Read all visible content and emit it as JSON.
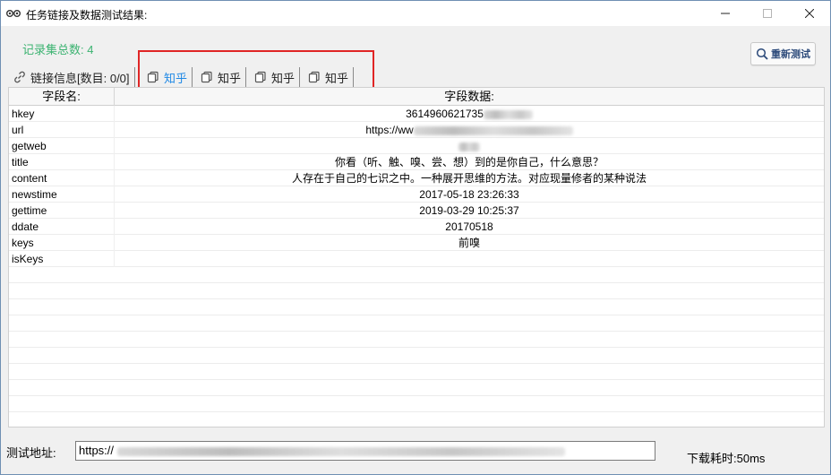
{
  "window": {
    "title": "任务链接及数据测试结果:",
    "icons": {
      "app": "eyes-icon",
      "minimize": "minimize-icon",
      "maximize": "maximize-icon",
      "close": "close-icon"
    }
  },
  "summary": {
    "record_count": "记录集总数: 4"
  },
  "toolbar": {
    "retest_label": "重新测试",
    "retest_icon": "search-icon"
  },
  "tabs": [
    {
      "label": "链接信息[数目: 0/0]",
      "icon": "link-icon"
    },
    {
      "label": "知乎",
      "icon": "copy-icon",
      "active": true
    },
    {
      "label": "知乎",
      "icon": "copy-icon"
    },
    {
      "label": "知乎",
      "icon": "copy-icon"
    },
    {
      "label": "知乎",
      "icon": "copy-icon"
    }
  ],
  "grid": {
    "headers": {
      "name": "字段名:",
      "value": "字段数据:"
    },
    "rows": [
      {
        "name": "hkey",
        "value": "3614960621735"
      },
      {
        "name": "url",
        "value": "https://ww"
      },
      {
        "name": "getweb",
        "value": ""
      },
      {
        "name": "title",
        "value": "你看（听、触、嗅、尝、想）到的是你自己，什么意思？"
      },
      {
        "name": "content",
        "value": "人存在于自己的七识之中。一种展开思维的方法。对应现量修者的某种说法"
      },
      {
        "name": "newstime",
        "value": "2017-05-18 23:26:33"
      },
      {
        "name": "gettime",
        "value": "2019-03-29 10:25:37"
      },
      {
        "name": "ddate",
        "value": "20170518"
      },
      {
        "name": "keys",
        "value": "前嗅"
      },
      {
        "name": "isKeys",
        "value": ""
      }
    ]
  },
  "footer": {
    "url_label": "测试地址:",
    "url_value": "https://",
    "download_time": "下载耗时:50ms"
  },
  "colors": {
    "record_count": "#3cb371",
    "active_tab": "#1e88e5",
    "highlight": "#e02525"
  }
}
